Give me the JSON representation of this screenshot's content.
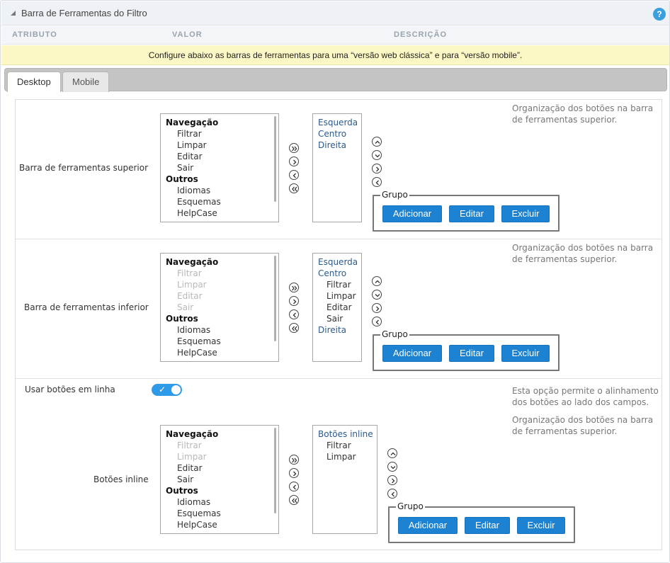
{
  "header": {
    "title": "Barra de Ferramentas do Filtro",
    "help": "?"
  },
  "columns": {
    "attribute": "ATRIBUTO",
    "value": "VALOR",
    "description": "DESCRIÇÃO"
  },
  "notice": "Configure abaixo as barras de ferramentas para uma “versão web clássica” e para “versão mobile”.",
  "tabs": [
    {
      "label": "Desktop",
      "active": true
    },
    {
      "label": "Mobile",
      "active": false
    }
  ],
  "top_toolbar": {
    "label": "Barra de ferramentas superior",
    "description": [
      "Organização dos botões na barra",
      "de ferramentas superior."
    ],
    "available": {
      "g1": "Navegação",
      "i1": "Filtrar",
      "i2": "Limpar",
      "i3": "Editar",
      "i4": "Sair",
      "g2": "Outros",
      "i5": "Idiomas",
      "i6": "Esquemas",
      "i7": "HelpCase"
    },
    "selected": {
      "s1": "Esquerda",
      "s2": "Centro",
      "s3": "Direita"
    },
    "group": {
      "legend": "Grupo",
      "add": "Adicionar",
      "edit": "Editar",
      "delete": "Excluir"
    }
  },
  "bottom_toolbar": {
    "label": "Barra de ferramentas inferior",
    "description": [
      "Organização dos botões na barra",
      "de ferramentas superior."
    ],
    "available": {
      "g1": "Navegação",
      "i1": "Filtrar",
      "i2": "Limpar",
      "i3": "Editar",
      "i4": "Sair",
      "g2": "Outros",
      "i5": "Idiomas",
      "i6": "Esquemas",
      "i7": "HelpCase"
    },
    "selected": {
      "s1": "Esquerda",
      "s2": "Centro",
      "c1": "Filtrar",
      "c2": "Limpar",
      "c3": "Editar",
      "c4": "Sair",
      "s3": "Direita"
    },
    "group": {
      "legend": "Grupo",
      "add": "Adicionar",
      "edit": "Editar",
      "delete": "Excluir"
    }
  },
  "inline": {
    "toggle_label": "Usar botões em linha",
    "toggle_on": true,
    "toggle_check": "✓",
    "toggle_description": [
      "Esta opção permite o alinhamento",
      "dos botões ao lado dos campos."
    ],
    "label": "Botões inline",
    "description": [
      "Organização dos botões na barra",
      "de ferramentas superior."
    ],
    "available": {
      "g1": "Navegação",
      "i1": "Filtrar",
      "i2": "Limpar",
      "i3": "Editar",
      "i4": "Sair",
      "g2": "Outros",
      "i5": "Idiomas",
      "i6": "Esquemas",
      "i7": "HelpCase"
    },
    "selected": {
      "s1": "Botões inline",
      "c1": "Filtrar",
      "c2": "Limpar"
    },
    "group": {
      "legend": "Grupo",
      "add": "Adicionar",
      "edit": "Editar",
      "delete": "Excluir"
    }
  },
  "icons": {
    "move_all_right": "double-chevron-right-icon",
    "move_right": "chevron-right-icon",
    "move_left": "chevron-left-icon",
    "move_all_left": "double-chevron-left-icon",
    "move_up": "chevron-up-icon",
    "move_down": "chevron-down-icon"
  },
  "colors": {
    "accent": "#1e82d2",
    "notice_bg": "#fcf8c5",
    "toggle": "#2f9be8",
    "link_text": "#2a5a8c"
  }
}
